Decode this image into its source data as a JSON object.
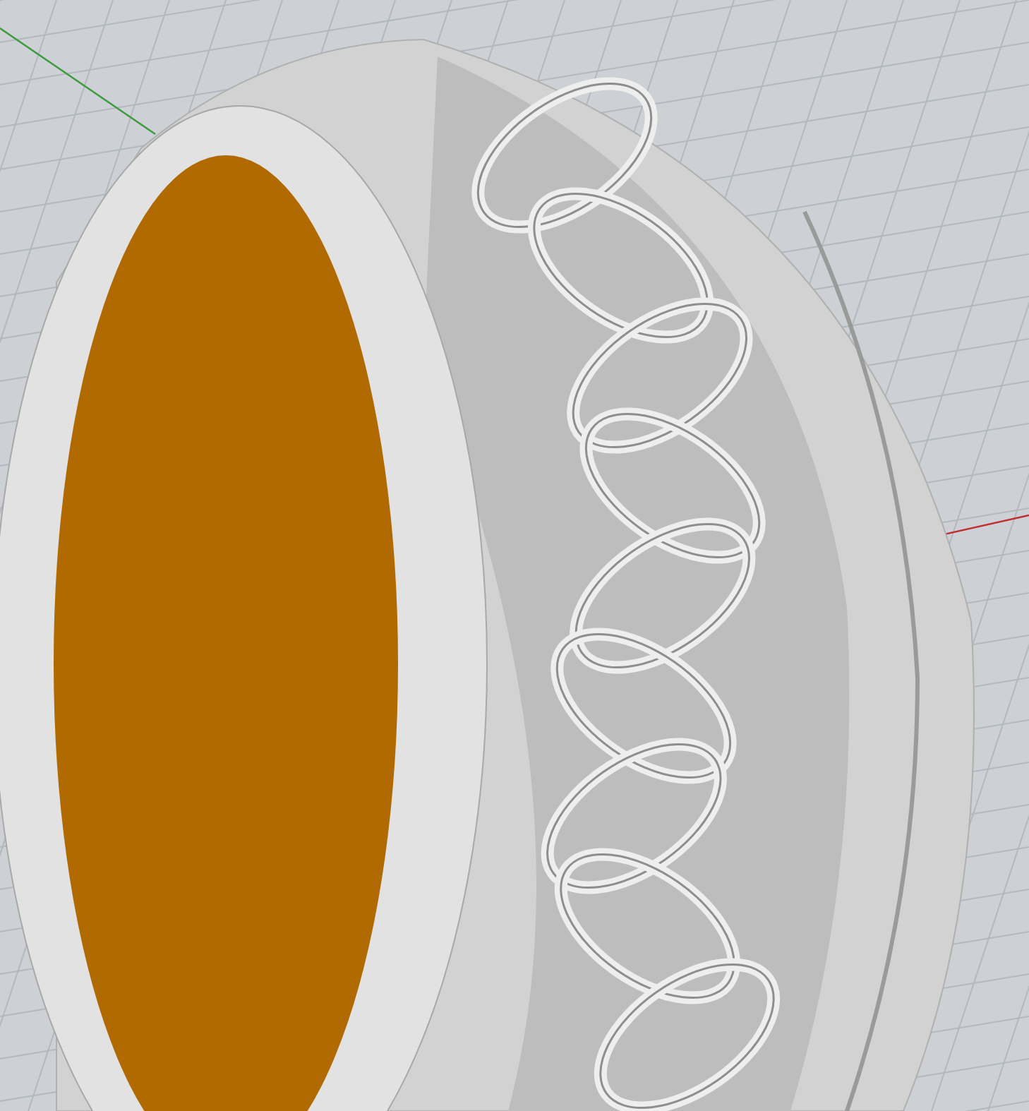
{
  "viewport": {
    "grid_visible": true,
    "axes_visible": true
  },
  "model": {
    "kind": "ring"
  }
}
